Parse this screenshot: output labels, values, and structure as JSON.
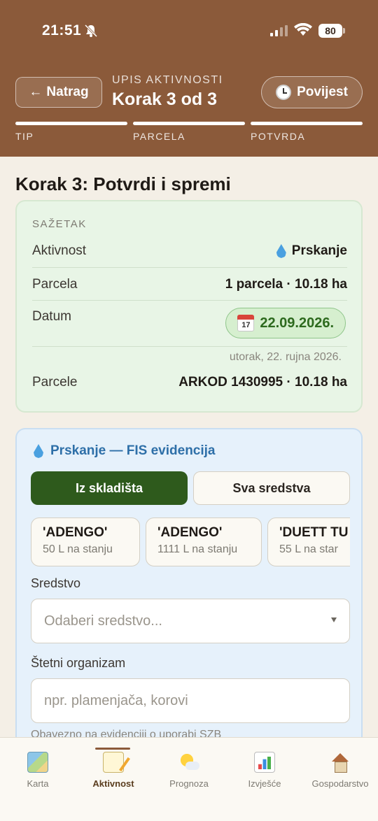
{
  "status": {
    "time": "21:51",
    "battery": "80"
  },
  "header": {
    "back_label": "Natrag",
    "subtitle": "UPIS AKTIVNOSTI",
    "title": "Korak 3 od 3",
    "history_label": "Povijest",
    "steps": [
      "TIP",
      "PARCELA",
      "POTVRDA"
    ]
  },
  "page_heading": "Korak 3: Potvrdi i spremi",
  "summary": {
    "caption": "SAŽETAK",
    "activity_key": "Aktivnost",
    "activity_value": "Prskanje",
    "parcel_key": "Parcela",
    "parcel_value": "1 parcela · 10.18 ha",
    "date_key": "Datum",
    "date_value": "22.09.2026.",
    "calendar_day": "17",
    "date_long": "utorak, 22. rujna 2026.",
    "parcels_key": "Parcele",
    "parcels_value": "ARKOD 1430995 · 10.18 ha"
  },
  "fis": {
    "title": "Prskanje — FIS evidencija",
    "seg_stock": "Iz skladišta",
    "seg_all": "Sva sredstva",
    "products": [
      {
        "name": "'ADENGO'",
        "stock": "50 L na stanju"
      },
      {
        "name": "'ADENGO'",
        "stock": "1111 L na stanju"
      },
      {
        "name": "'DUETT TU",
        "stock": "55 L na star"
      }
    ],
    "product_label": "Sredstvo",
    "product_placeholder": "Odaberi sredstvo...",
    "pest_label": "Štetni organizam",
    "pest_placeholder": "npr. plamenjača, korovi",
    "note": "Obavezno na evidenciji o uporabi SZB"
  },
  "tabs": [
    {
      "label": "Karta",
      "icon": "map-icon"
    },
    {
      "label": "Aktivnost",
      "icon": "memo-icon",
      "active": true
    },
    {
      "label": "Prognoza",
      "icon": "sun-cloud-icon"
    },
    {
      "label": "Izvješće",
      "icon": "bar-chart-icon"
    },
    {
      "label": "Gospodarstvo",
      "icon": "house-icon"
    }
  ],
  "colors": {
    "header": "#8b5a3a",
    "accent_green": "#2e5a1c",
    "fis_blue": "#2e6fa8"
  }
}
